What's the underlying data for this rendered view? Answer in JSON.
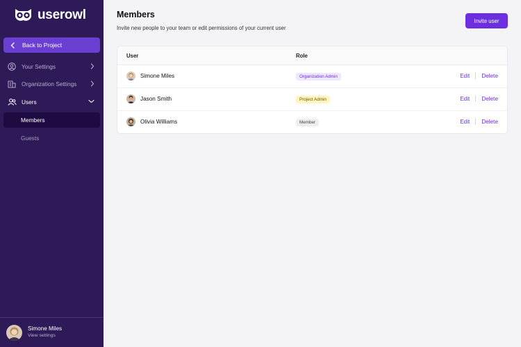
{
  "brand": {
    "name": "userowl"
  },
  "sidebar": {
    "back_label": "Back to Project",
    "items": [
      {
        "label": "Your Settings"
      },
      {
        "label": "Organization Settings"
      },
      {
        "label": "Users"
      }
    ],
    "sub_items": [
      {
        "label": "Members"
      },
      {
        "label": "Guests"
      }
    ],
    "footer": {
      "name": "Simone Miles",
      "link": "View settings"
    }
  },
  "main": {
    "title": "Members",
    "subtitle": "Invite new people to your team or edit permissions of your current user",
    "invite_label": "Invite user",
    "columns": {
      "user": "User",
      "role": "Role"
    },
    "rows": [
      {
        "name": "Simone Miles",
        "role": "Organization Admin",
        "edit": "Edit",
        "delete": "Delete"
      },
      {
        "name": "Jason Smith",
        "role": "Project Admin",
        "edit": "Edit",
        "delete": "Delete"
      },
      {
        "name": "Olivia Williams",
        "role": "Member",
        "edit": "Edit",
        "delete": "Delete"
      }
    ]
  },
  "colors": {
    "sidebar_bg": "#2e1a57",
    "accent": "#6b2fe0",
    "badge_org_admin_bg": "#efe6ff",
    "badge_org_admin_fg": "#6b2fe0",
    "badge_project_admin_bg": "#fff5bf",
    "badge_project_admin_fg": "#6b5300",
    "badge_member_bg": "#eeeeee",
    "badge_member_fg": "#444444"
  }
}
